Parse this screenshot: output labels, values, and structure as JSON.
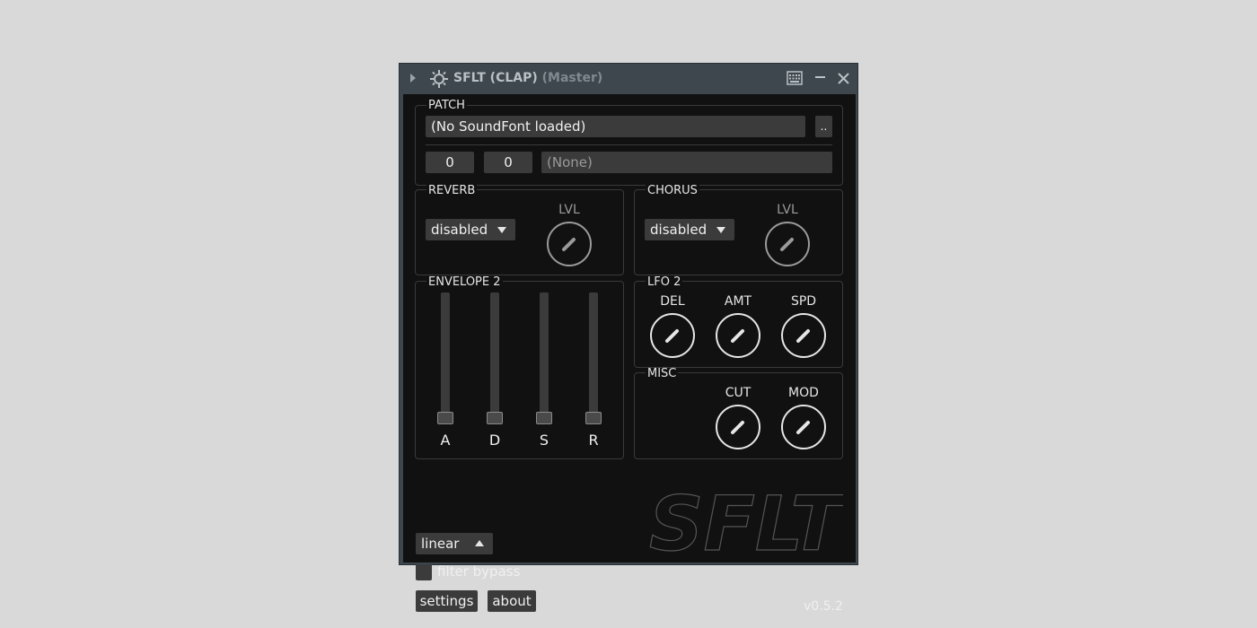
{
  "window": {
    "title": "SFLT (CLAP)",
    "subtitle": "(Master)"
  },
  "patch": {
    "label": "PATCH",
    "soundfont": "(No SoundFont loaded)",
    "browse_label": "..",
    "bank": "0",
    "program": "0",
    "preset_name": "(None)"
  },
  "reverb": {
    "label": "REVERB",
    "mode": "disabled",
    "level_label": "LVL"
  },
  "chorus": {
    "label": "CHORUS",
    "mode": "disabled",
    "level_label": "LVL"
  },
  "envelope": {
    "label": "ENVELOPE 2",
    "sliders": [
      {
        "label": "A",
        "value": 0
      },
      {
        "label": "D",
        "value": 0
      },
      {
        "label": "S",
        "value": 0
      },
      {
        "label": "R",
        "value": 0
      }
    ]
  },
  "lfo": {
    "label": "LFO 2",
    "knobs": [
      {
        "label": "DEL"
      },
      {
        "label": "AMT"
      },
      {
        "label": "SPD"
      }
    ]
  },
  "misc": {
    "label": "MISC",
    "knobs": [
      {
        "label": "CUT"
      },
      {
        "label": "MOD"
      }
    ]
  },
  "bottom": {
    "interpolation": "linear",
    "filter_bypass_label": "filter bypass",
    "filter_bypass_checked": false,
    "settings_label": "settings",
    "about_label": "about",
    "version": "v0.5.2",
    "logo_text": "SFLT"
  },
  "colors": {
    "titlebar": "#3e474d",
    "panel": "#111111",
    "control": "#3b3b3b",
    "text": "#e6e6e6"
  }
}
